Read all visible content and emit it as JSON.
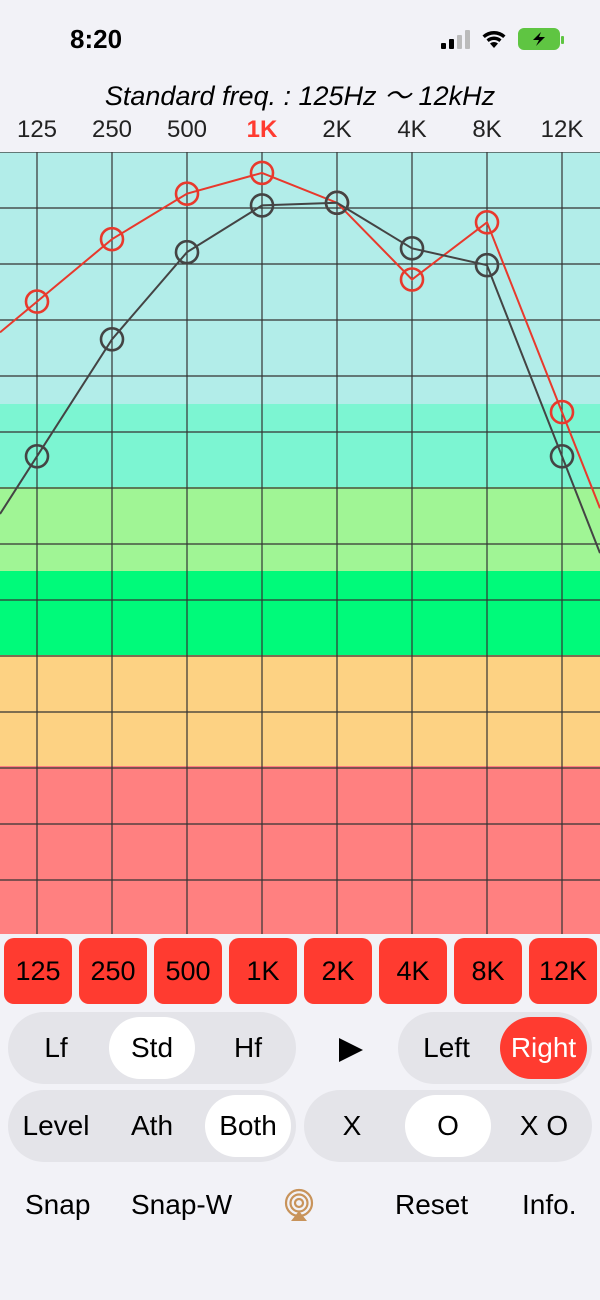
{
  "status": {
    "time": "8:20"
  },
  "header": {
    "subtitle": "Standard freq. : 125Hz 〜 12kHz"
  },
  "frequencies": [
    "125",
    "250",
    "500",
    "1K",
    "2K",
    "4K",
    "8K",
    "12K"
  ],
  "active_frequency": "1K",
  "colors": {
    "accent": "#ff3b30",
    "zone_1": "#b2ede9",
    "zone_2": "#7cf5d2",
    "zone_3": "#a0f595",
    "zone_4": "#00fa7a",
    "zone_5": "#fdd283",
    "zone_6": "#ff8080",
    "right_ear": "#e8392c",
    "left_ear": "#444444"
  },
  "chart_data": {
    "type": "line",
    "x": [
      "125",
      "250",
      "500",
      "1K",
      "2K",
      "4K",
      "8K",
      "12K"
    ],
    "series": [
      {
        "color": "#e8392c",
        "marker": "circle",
        "values": [
          0.232,
          0.184,
          0.149,
          0.133,
          0.156,
          0.215,
          0.171,
          0.317
        ]
      },
      {
        "color": "#444444",
        "marker": "circle",
        "values": [
          0.351,
          0.261,
          0.194,
          0.158,
          0.156,
          0.191,
          0.204,
          0.351
        ]
      }
    ]
  },
  "controls": {
    "range": {
      "options": [
        "Lf",
        "Std",
        "Hf"
      ],
      "selected": "Std"
    },
    "play_icon": "play-icon",
    "ear": {
      "options": [
        "Left",
        "Right"
      ],
      "selected": "Right"
    },
    "mode": {
      "options": [
        "Level",
        "Ath",
        "Both"
      ],
      "selected": "Both"
    },
    "marker": {
      "options": [
        "X",
        "O",
        "X O"
      ],
      "selected": "O"
    }
  },
  "bottom_bar": {
    "snap": "Snap",
    "snap_w": "Snap-W",
    "airplay_icon": "airplay-icon",
    "reset": "Reset",
    "info": "Info."
  }
}
